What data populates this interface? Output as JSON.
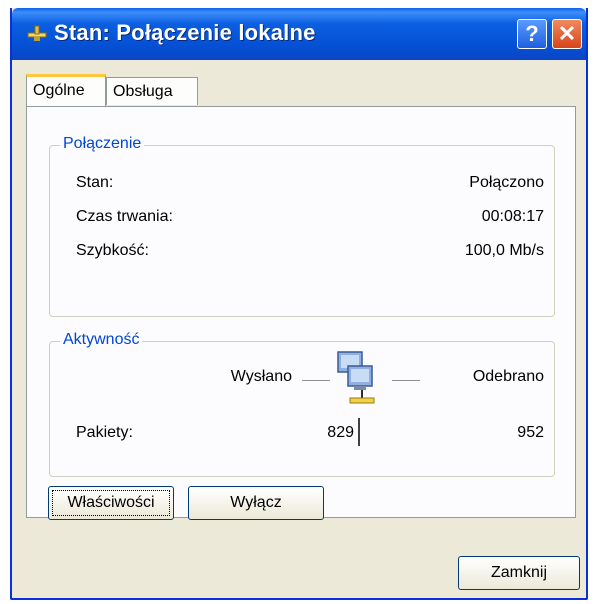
{
  "window": {
    "title": "Stan: Połączenie lokalne",
    "help_label": "?",
    "close_label": "✕"
  },
  "tabs": [
    {
      "label": "Ogólne",
      "active": true
    },
    {
      "label": "Obsługa",
      "active": false
    }
  ],
  "connection": {
    "group_label": "Połączenie",
    "rows": [
      {
        "label": "Stan:",
        "value": "Połączono"
      },
      {
        "label": "Czas trwania:",
        "value": "00:08:17"
      },
      {
        "label": "Szybkość:",
        "value": "100,0 Mb/s"
      }
    ]
  },
  "activity": {
    "group_label": "Aktywność",
    "sent_label": "Wysłano",
    "received_label": "Odebrano",
    "packets_label": "Pakiety:",
    "packets_sent": "829",
    "packets_received": "952"
  },
  "buttons": {
    "properties": "Właściwości",
    "disable": "Wyłącz",
    "close": "Zamknij"
  },
  "colors": {
    "titlebar": "#0551d6",
    "group_title": "#0046d5",
    "tab_highlight": "#ffc83c",
    "close_button": "#d8441a"
  },
  "icons": {
    "title": "network-plug-icon",
    "activity": "network-computers-icon"
  }
}
